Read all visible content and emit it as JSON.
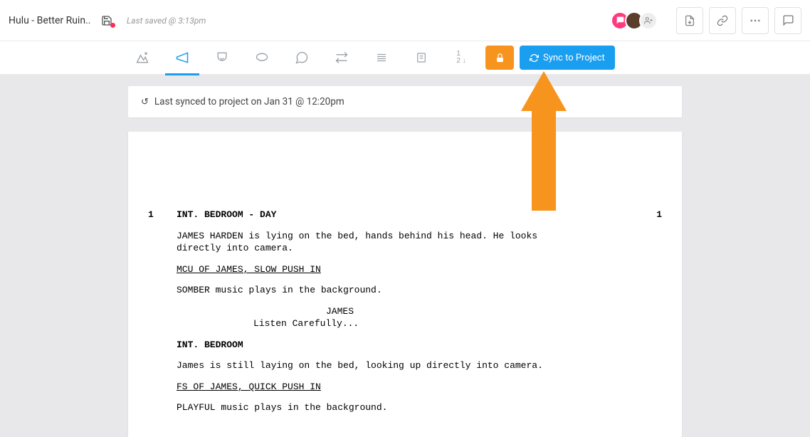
{
  "header": {
    "title": "Hulu - Better Ruin..",
    "last_saved": "Last saved @ 3:13pm"
  },
  "toolbar": {
    "sync_label": "Sync to Project"
  },
  "banner": {
    "text": "Last synced to project on Jan 31 @ 12:20pm"
  },
  "script": {
    "scene1_num_left": "1",
    "scene1_num_right": "1",
    "scene1_head": "INT. BEDROOM - DAY",
    "action1": "JAMES HARDEN is lying on the bed, hands behind his head. He looks directly into camera.",
    "shot1": "MCU OF JAMES, SLOW PUSH IN",
    "action2": "SOMBER music plays in the background.",
    "char1": "JAMES",
    "dialog1": "Listen Carefully...",
    "scene2_head": "INT. BEDROOM",
    "action3": "James is still laying on the bed, looking up directly into camera.",
    "shot2": "FS OF JAMES, QUICK PUSH IN",
    "action4": "PLAYFUL music plays in the background."
  }
}
